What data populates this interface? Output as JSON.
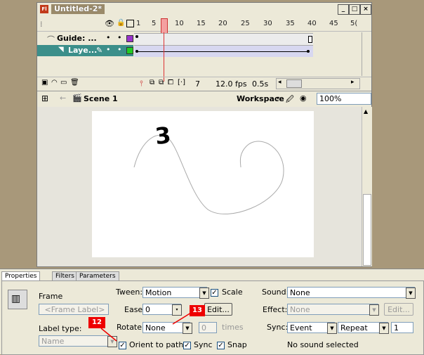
{
  "window": {
    "title": "Untitled-2*",
    "app_icon": "Fl",
    "controls": [
      "_",
      "□",
      "×"
    ]
  },
  "timeline": {
    "ruler": [
      "1",
      "5",
      "10",
      "15",
      "20",
      "25",
      "30",
      "35",
      "40",
      "45",
      "5("
    ],
    "layers": [
      {
        "name": "Guide: ...",
        "selected": false
      },
      {
        "name": "Laye...",
        "selected": true
      }
    ],
    "current_frame": "7",
    "fps": "12.0 fps",
    "time": "0.5s"
  },
  "editbar": {
    "scene": "Scene 1",
    "workspace": "Workspace",
    "zoom": "100%"
  },
  "stage": {
    "text": "3"
  },
  "properties": {
    "tabs": [
      "Properties",
      "Filters",
      "Parameters"
    ],
    "frame_label_title": "Frame",
    "frame_label_placeholder": "<Frame Label>",
    "label_type_label": "Label type:",
    "label_type_value": "Name",
    "tween_label": "Tween:",
    "tween_value": "Motion",
    "scale_label": "Scale",
    "ease_label": "Ease:",
    "ease_value": "0",
    "edit_button": "Edit...",
    "rotate_label": "Rotate:",
    "rotate_value": "None",
    "rotate_times_value": "0",
    "times_label": "times",
    "orient_label": "Orient to path",
    "sync_check_label": "Sync",
    "snap_label": "Snap",
    "sound_label": "Sound:",
    "sound_value": "None",
    "effect_label": "Effect:",
    "effect_value": "None",
    "effect_edit_button": "Edit...",
    "sync_label": "Sync:",
    "sync_value": "Event",
    "repeat_value": "Repeat",
    "repeat_count": "1",
    "no_sound_text": "No sound selected"
  },
  "callouts": {
    "c12": "12",
    "c13": "13"
  },
  "colors": {
    "accent_layer": "#3c8f8a",
    "callout": "#e00000",
    "playhead": "#d33333"
  }
}
